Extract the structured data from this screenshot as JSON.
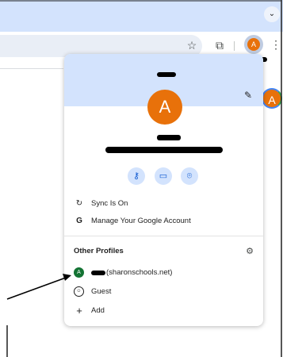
{
  "popup": {
    "avatar_letter": "A",
    "sync_label": "Sync Is On",
    "manage_label": "Manage Your Google Account",
    "other_profiles_title": "Other Profiles",
    "profile_domain": "(sharonschools.net)",
    "profile_letter": "A",
    "guest_label": "Guest",
    "add_label": "Add"
  },
  "toolbar": {
    "avatar_letter": "A"
  },
  "background": {
    "avatar_letter": "A"
  },
  "colors": {
    "accent": "#d3e3fd",
    "avatar": "#e8710a",
    "profile_avatar": "#137333"
  }
}
